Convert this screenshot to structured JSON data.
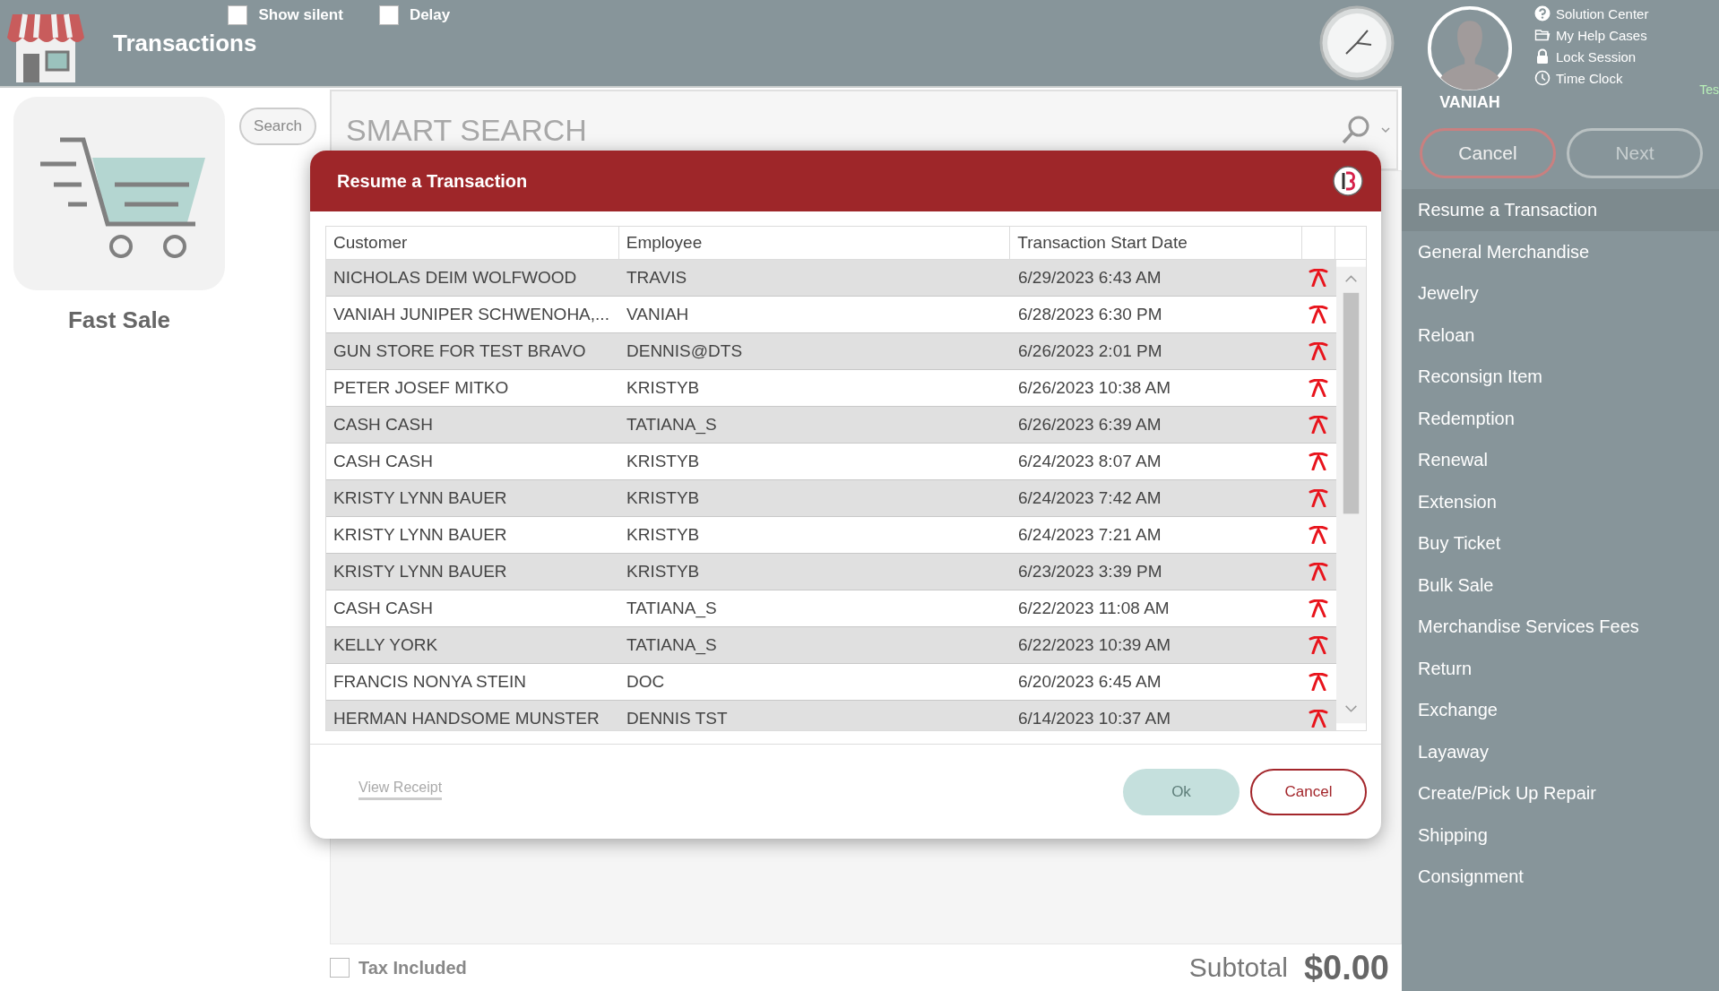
{
  "header": {
    "title": "Transactions",
    "options": [
      {
        "label": "Show silent",
        "checked": false
      },
      {
        "label": "Delay",
        "checked": false
      }
    ]
  },
  "user": {
    "name": "VANIAH"
  },
  "help_links": [
    {
      "label": "Solution Center",
      "kind": "question"
    },
    {
      "label": "My Help Cases",
      "kind": "folder"
    },
    {
      "label": "Lock Session",
      "kind": "lock"
    },
    {
      "label": "Time Clock",
      "kind": "clock"
    }
  ],
  "corner_text": "Tes",
  "actions": [
    {
      "label": "Cancel",
      "kind": "cancel"
    },
    {
      "label": "Next",
      "kind": "next"
    }
  ],
  "menu": [
    {
      "label": "Resume a Transaction",
      "selected": true
    },
    {
      "label": "General Merchandise",
      "selected": false
    },
    {
      "label": "Jewelry",
      "selected": false
    },
    {
      "label": "Reloan",
      "selected": false
    },
    {
      "label": "Reconsign Item",
      "selected": false
    },
    {
      "label": "Redemption",
      "selected": false
    },
    {
      "label": "Renewal",
      "selected": false
    },
    {
      "label": "Extension",
      "selected": false
    },
    {
      "label": "Buy Ticket",
      "selected": false
    },
    {
      "label": "Bulk Sale",
      "selected": false
    },
    {
      "label": "Merchandise Services Fees",
      "selected": false
    },
    {
      "label": "Return",
      "selected": false
    },
    {
      "label": "Exchange",
      "selected": false
    },
    {
      "label": "Layaway",
      "selected": false
    },
    {
      "label": "Create/Pick Up Repair",
      "selected": false
    },
    {
      "label": "Shipping",
      "selected": false
    },
    {
      "label": "Consignment",
      "selected": false
    }
  ],
  "tile": {
    "label": "Fast Sale"
  },
  "search_button": "Search",
  "smart_search": {
    "placeholder": "SMART SEARCH"
  },
  "dialog": {
    "title": "Resume a Transaction",
    "table": {
      "columns": [
        "Customer",
        "Employee",
        "Transaction Start Date"
      ],
      "rows": [
        {
          "customer": "NICHOLAS DEIM WOLFWOOD",
          "employee": "TRAVIS",
          "date": "6/29/2023 6:43 AM"
        },
        {
          "customer": "VANIAH JUNIPER SCHWENOHA,...",
          "employee": "VANIAH",
          "date": "6/28/2023 6:30 PM"
        },
        {
          "customer": "GUN STORE FOR TEST BRAVO",
          "employee": "DENNIS@DTS",
          "date": "6/26/2023 2:01 PM"
        },
        {
          "customer": "PETER JOSEF MITKO",
          "employee": "KRISTYB",
          "date": "6/26/2023 10:38 AM"
        },
        {
          "customer": "CASH CASH",
          "employee": "TATIANA_S",
          "date": "6/26/2023 6:39 AM"
        },
        {
          "customer": "CASH CASH",
          "employee": "KRISTYB",
          "date": "6/24/2023 8:07 AM"
        },
        {
          "customer": "KRISTY LYNN BAUER",
          "employee": "KRISTYB",
          "date": "6/24/2023 7:42 AM"
        },
        {
          "customer": "KRISTY LYNN BAUER",
          "employee": "KRISTYB",
          "date": "6/24/2023 7:21 AM"
        },
        {
          "customer": "KRISTY LYNN BAUER",
          "employee": "KRISTYB",
          "date": "6/23/2023 3:39 PM"
        },
        {
          "customer": "CASH CASH",
          "employee": "TATIANA_S",
          "date": "6/22/2023 11:08 AM"
        },
        {
          "customer": "KELLY YORK",
          "employee": "TATIANA_S",
          "date": "6/22/2023 10:39 AM"
        },
        {
          "customer": "FRANCIS NONYA STEIN",
          "employee": "DOC",
          "date": "6/20/2023 6:45 AM"
        },
        {
          "customer": "HERMAN HANDSOME MUNSTER",
          "employee": "DENNIS TST",
          "date": "6/14/2023 10:37 AM"
        }
      ]
    },
    "link": "View Receipt",
    "buttons": [
      {
        "label": "Ok",
        "disabled": true
      },
      {
        "label": "Cancel",
        "disabled": false
      }
    ]
  },
  "footer": {
    "tax_included": {
      "label": "Tax Included",
      "checked": false
    },
    "subtotal_label": "Subtotal",
    "subtotal": "$0.00"
  }
}
